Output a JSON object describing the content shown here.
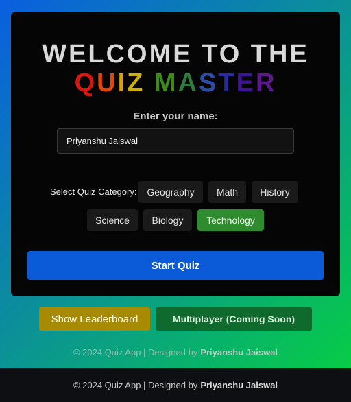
{
  "title": {
    "line1": "WELCOME TO THE",
    "line2_letters": [
      {
        "ch": "Q",
        "color": "#d8170f"
      },
      {
        "ch": "U",
        "color": "#e0460c"
      },
      {
        "ch": "I",
        "color": "#d9a20a"
      },
      {
        "ch": "Z",
        "color": "#c9b00a"
      },
      {
        "ch": " ",
        "color": "#ffffff"
      },
      {
        "ch": "M",
        "color": "#3c8a18"
      },
      {
        "ch": "A",
        "color": "#2f7a3c"
      },
      {
        "ch": "S",
        "color": "#2c4ea8"
      },
      {
        "ch": "T",
        "color": "#2a2ba0"
      },
      {
        "ch": "E",
        "color": "#3d1498"
      },
      {
        "ch": "R",
        "color": "#5a1a8a"
      }
    ]
  },
  "name_field": {
    "label": "Enter your name:",
    "value": "Priyanshu Jaiswal"
  },
  "categories": {
    "label": "Select Quiz Category:",
    "items": [
      "Geography",
      "Math",
      "History",
      "Science",
      "Biology",
      "Technology"
    ],
    "selected": "Technology"
  },
  "start_button": "Start Quiz",
  "leaderboard_button": "Show Leaderboard",
  "multiplayer_button": "Multiplayer (Coming Soon)",
  "copyright": {
    "text": "© 2024 Quiz App | Designed by",
    "author": "Priyanshu Jaiswal"
  },
  "colors": {
    "accent_blue": "#0b5bd8",
    "selected_green": "#2e8b2e",
    "leaderboard_gold": "#a88a00",
    "multiplayer_green": "#0f6a2e"
  }
}
